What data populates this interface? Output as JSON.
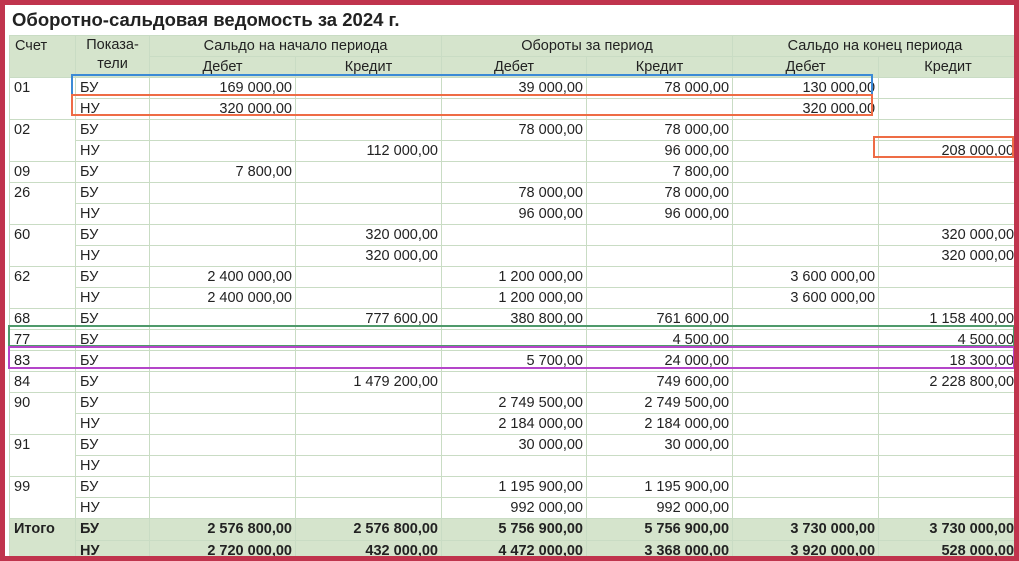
{
  "title": "Оборотно-сальдовая ведомость за 2024 г.",
  "headers": {
    "account": "Счет",
    "indicator": "Показа-\nтели",
    "groups": [
      "Сальдо на начало периода",
      "Обороты за период",
      "Сальдо на конец периода"
    ],
    "debit": "Дебет",
    "credit": "Кредит"
  },
  "accounts": [
    {
      "account": "01",
      "rows": [
        {
          "ind": "БУ",
          "v": [
            "169 000,00",
            "",
            "39 000,00",
            "78 000,00",
            "130 000,00",
            ""
          ]
        },
        {
          "ind": "НУ",
          "v": [
            "320 000,00",
            "",
            "",
            "",
            "320 000,00",
            ""
          ]
        }
      ]
    },
    {
      "account": "02",
      "rows": [
        {
          "ind": "БУ",
          "v": [
            "",
            "",
            "78 000,00",
            "78 000,00",
            "",
            ""
          ]
        },
        {
          "ind": "НУ",
          "v": [
            "",
            "112 000,00",
            "",
            "96 000,00",
            "",
            "208 000,00"
          ]
        }
      ]
    },
    {
      "account": "09",
      "rows": [
        {
          "ind": "БУ",
          "v": [
            "7 800,00",
            "",
            "",
            "7 800,00",
            "",
            ""
          ]
        }
      ]
    },
    {
      "account": "26",
      "rows": [
        {
          "ind": "БУ",
          "v": [
            "",
            "",
            "78 000,00",
            "78 000,00",
            "",
            ""
          ]
        },
        {
          "ind": "НУ",
          "v": [
            "",
            "",
            "96 000,00",
            "96 000,00",
            "",
            ""
          ]
        }
      ]
    },
    {
      "account": "60",
      "rows": [
        {
          "ind": "БУ",
          "v": [
            "",
            "320 000,00",
            "",
            "",
            "",
            "320 000,00"
          ]
        },
        {
          "ind": "НУ",
          "v": [
            "",
            "320 000,00",
            "",
            "",
            "",
            "320 000,00"
          ]
        }
      ]
    },
    {
      "account": "62",
      "rows": [
        {
          "ind": "БУ",
          "v": [
            "2 400 000,00",
            "",
            "1 200 000,00",
            "",
            "3 600 000,00",
            ""
          ]
        },
        {
          "ind": "НУ",
          "v": [
            "2 400 000,00",
            "",
            "1 200 000,00",
            "",
            "3 600 000,00",
            ""
          ]
        }
      ]
    },
    {
      "account": "68",
      "rows": [
        {
          "ind": "БУ",
          "v": [
            "",
            "777 600,00",
            "380 800,00",
            "761 600,00",
            "",
            "1 158 400,00"
          ]
        }
      ]
    },
    {
      "account": "77",
      "rows": [
        {
          "ind": "БУ",
          "v": [
            "",
            "",
            "",
            "4 500,00",
            "",
            "4 500,00"
          ]
        }
      ]
    },
    {
      "account": "83",
      "rows": [
        {
          "ind": "БУ",
          "v": [
            "",
            "",
            "5 700,00",
            "24 000,00",
            "",
            "18 300,00"
          ]
        }
      ]
    },
    {
      "account": "84",
      "rows": [
        {
          "ind": "БУ",
          "v": [
            "",
            "1 479 200,00",
            "",
            "749 600,00",
            "",
            "2 228 800,00"
          ]
        }
      ]
    },
    {
      "account": "90",
      "rows": [
        {
          "ind": "БУ",
          "v": [
            "",
            "",
            "2 749 500,00",
            "2 749 500,00",
            "",
            ""
          ]
        },
        {
          "ind": "НУ",
          "v": [
            "",
            "",
            "2 184 000,00",
            "2 184 000,00",
            "",
            ""
          ]
        }
      ]
    },
    {
      "account": "91",
      "rows": [
        {
          "ind": "БУ",
          "v": [
            "",
            "",
            "30 000,00",
            "30 000,00",
            "",
            ""
          ]
        },
        {
          "ind": "НУ",
          "v": [
            "",
            "",
            "",
            "",
            "",
            ""
          ]
        }
      ]
    },
    {
      "account": "99",
      "rows": [
        {
          "ind": "БУ",
          "v": [
            "",
            "",
            "1 195 900,00",
            "1 195 900,00",
            "",
            ""
          ]
        },
        {
          "ind": "НУ",
          "v": [
            "",
            "",
            "992 000,00",
            "992 000,00",
            "",
            ""
          ]
        }
      ]
    }
  ],
  "totals": {
    "label": "Итого",
    "rows": [
      {
        "ind": "БУ",
        "v": [
          "2 576 800,00",
          "2 576 800,00",
          "5 756 900,00",
          "5 756 900,00",
          "3 730 000,00",
          "3 730 000,00"
        ]
      },
      {
        "ind": "НУ",
        "v": [
          "2 720 000,00",
          "432 000,00",
          "4 472 000,00",
          "3 368 000,00",
          "3 920 000,00",
          "528 000,00"
        ]
      }
    ]
  },
  "highlight_colors": {
    "frame": "#c0344d",
    "blue": "#3b8ad6",
    "orange": "#ee6c45",
    "green": "#4f9a6b",
    "purple": "#b445c9"
  }
}
